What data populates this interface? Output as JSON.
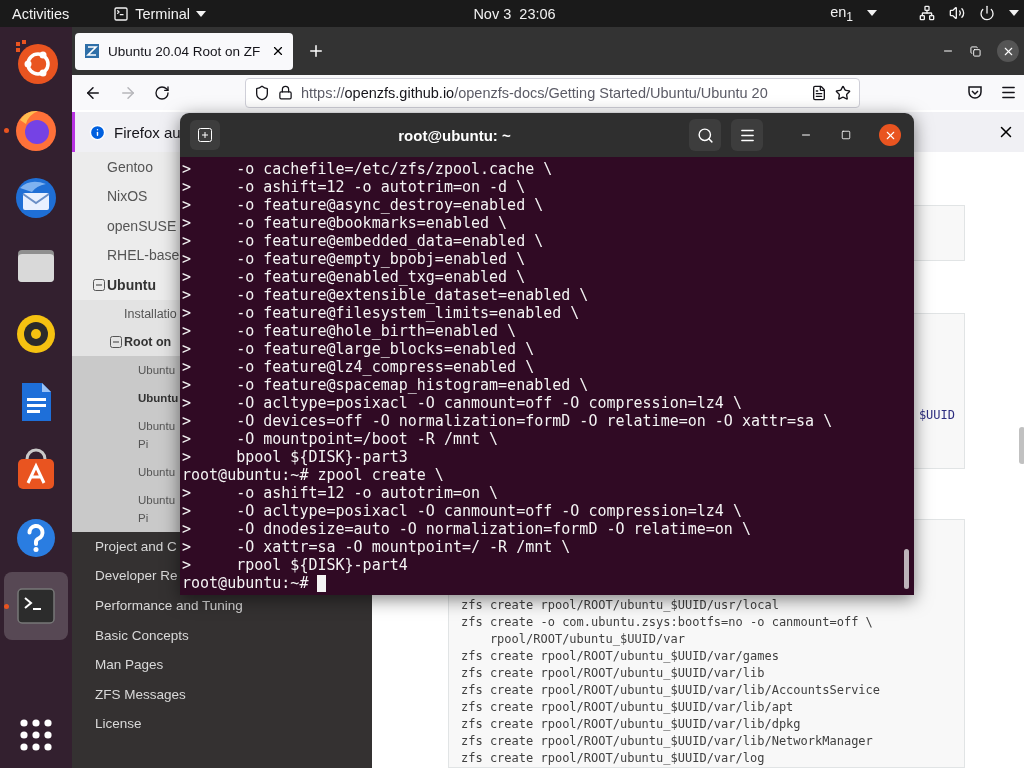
{
  "top_bar": {
    "activities": "Activities",
    "app_menu": "Terminal",
    "clock": "Nov 3  23:06",
    "input_source": "en$_{1}$"
  },
  "dock": {
    "apps": [
      {
        "kind": "installer",
        "running": false,
        "selected": false
      },
      {
        "kind": "browser",
        "running": true,
        "selected": false
      },
      {
        "kind": "mail",
        "running": false,
        "selected": false
      },
      {
        "kind": "files",
        "running": false,
        "selected": false
      },
      {
        "kind": "music",
        "running": false,
        "selected": false
      },
      {
        "kind": "writer",
        "running": false,
        "selected": false
      },
      {
        "kind": "software",
        "running": false,
        "selected": false
      },
      {
        "kind": "help",
        "running": false,
        "selected": false
      },
      {
        "kind": "terminal",
        "running": true,
        "selected": true
      }
    ]
  },
  "browser": {
    "tab": {
      "title": "Ubuntu 20.04 Root on ZF",
      "selected": true
    },
    "forward": {
      "disabled": true
    },
    "url": {
      "scheme": "https://",
      "host": "openzfs.github.io",
      "path": "/openzfs-docs/Getting Started/Ubuntu/Ubuntu 20"
    },
    "notification": {
      "text": "Firefox au"
    },
    "sidebar": {
      "current": [
        {
          "label": "Gentoo"
        },
        {
          "label": "NixOS"
        },
        {
          "label": "openSUSE"
        },
        {
          "label": "RHEL-base"
        },
        {
          "label": "Ubuntu",
          "expanded": true,
          "children": [
            {
              "label": "Installatio"
            },
            {
              "label": "Root on",
              "expanded": true,
              "children": [
                {
                  "label": "Ubuntu",
                  "selected": false
                },
                {
                  "label": "Ubuntu",
                  "selected": true
                },
                {
                  "label": "Ubuntu\nPi",
                  "selected": false
                },
                {
                  "label": "Ubuntu",
                  "selected": false
                },
                {
                  "label": "Ubuntu\nPi",
                  "selected": false
                }
              ]
            }
          ]
        }
      ],
      "items": [
        "Project and C",
        "Developer Re",
        "Performance and Tuning",
        "Basic Concepts",
        "Man Pages",
        "ZFS Messages",
        "License"
      ]
    },
    "content": {
      "block_2_line": "$UUID",
      "block_3_lines": [
        "zfs create rpool/ROOT/ubuntu_$UUID/usr/local",
        "zfs create -o com.ubuntu.zsys:bootfs=no -o canmount=off \\",
        "    rpool/ROOT/ubuntu_$UUID/var",
        "zfs create rpool/ROOT/ubuntu_$UUID/var/games",
        "zfs create rpool/ROOT/ubuntu_$UUID/var/lib",
        "zfs create rpool/ROOT/ubuntu_$UUID/var/lib/AccountsService",
        "zfs create rpool/ROOT/ubuntu_$UUID/var/lib/apt",
        "zfs create rpool/ROOT/ubuntu_$UUID/var/lib/dpkg",
        "zfs create rpool/ROOT/ubuntu_$UUID/var/lib/NetworkManager",
        "zfs create rpool/ROOT/ubuntu_$UUID/var/log"
      ]
    }
  },
  "terminal": {
    "title": "root@ubuntu: ~",
    "cursor": true,
    "lines": [
      ">     -o cachefile=/etc/zfs/zpool.cache \\",
      ">     -o ashift=12 -o autotrim=on -d \\",
      ">     -o feature@async_destroy=enabled \\",
      ">     -o feature@bookmarks=enabled \\",
      ">     -o feature@embedded_data=enabled \\",
      ">     -o feature@empty_bpobj=enabled \\",
      ">     -o feature@enabled_txg=enabled \\",
      ">     -o feature@extensible_dataset=enabled \\",
      ">     -o feature@filesystem_limits=enabled \\",
      ">     -o feature@hole_birth=enabled \\",
      ">     -o feature@large_blocks=enabled \\",
      ">     -o feature@lz4_compress=enabled \\",
      ">     -o feature@spacemap_histogram=enabled \\",
      ">     -O acltype=posixacl -O canmount=off -O compression=lz4 \\",
      ">     -O devices=off -O normalization=formD -O relatime=on -O xattr=sa \\",
      ">     -O mountpoint=/boot -R /mnt \\",
      ">     bpool ${DISK}-part3",
      "root@ubuntu:~# zpool create \\",
      ">     -o ashift=12 -o autotrim=on \\",
      ">     -O acltype=posixacl -O canmount=off -O compression=lz4 \\",
      ">     -O dnodesize=auto -O normalization=formD -O relatime=on \\",
      ">     -O xattr=sa -O mountpoint=/ -R /mnt \\",
      ">     rpool ${DISK}-part4",
      "root@ubuntu:~# "
    ]
  }
}
